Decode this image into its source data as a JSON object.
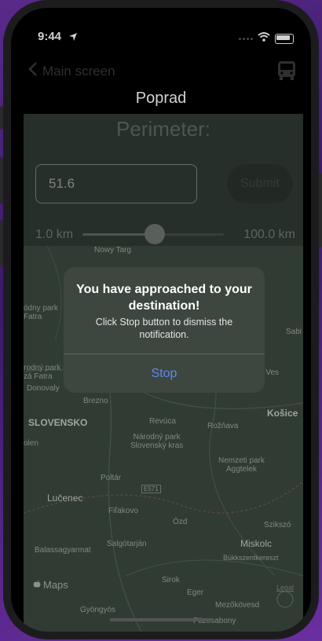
{
  "status_bar": {
    "time": "9:44"
  },
  "nav": {
    "back_label": "Main screen",
    "title": "Poprad"
  },
  "perimeter": {
    "title": "Perimeter:",
    "input_value": "51.6",
    "submit_label": "Submit",
    "slider_min_label": "1.0 km",
    "slider_max_label": "100.0 km",
    "slider_value_km": 51.6,
    "slider_min_km": 1.0,
    "slider_max_km": 100.0
  },
  "map": {
    "labels": {
      "nowy_targ": "Nowy Targ",
      "park_fatra": "ódny park\nFatra",
      "park_tatra": "rodný park\nzá Fatra",
      "donovaly": "Donovaly",
      "brezno": "Brezno",
      "slovensko": "SLOVENSKO",
      "olen": "olen",
      "revuca": "Revúca",
      "roznava": "Rožňava",
      "slovensky_kras": "Národný park\nSlovenský kras",
      "aggtelek": "Nemzeti park\nAggtelek",
      "kosice": "Košice",
      "ves": "á Ves",
      "sabi": "Sabi",
      "poltar": "Poltár",
      "lucenec": "Lučenec",
      "filakovo": "Fiľakovo",
      "e571": "E571",
      "ozd": "Ózd",
      "szikszo": "Szikszó",
      "balassagyarmat": "Balassagyarmat",
      "salgotarjan": "Salgótarján",
      "miskolc": "Miskolc",
      "bukkszentkereszt": "Bükkszentkereszt",
      "sirok": "Sirok",
      "eger": "Eger",
      "gyongyos": "Gyöngyös",
      "mezokovesd": "Mezőkövesd",
      "fuzesabony": "Füzesabony"
    },
    "maps_logo_label": "Maps",
    "legal_label": "Legal"
  },
  "alert": {
    "title": "You have approached to your destination!",
    "message": "Click Stop button to dismiss the notification.",
    "stop_label": "Stop"
  },
  "colors": {
    "accent": "#5b8def"
  }
}
